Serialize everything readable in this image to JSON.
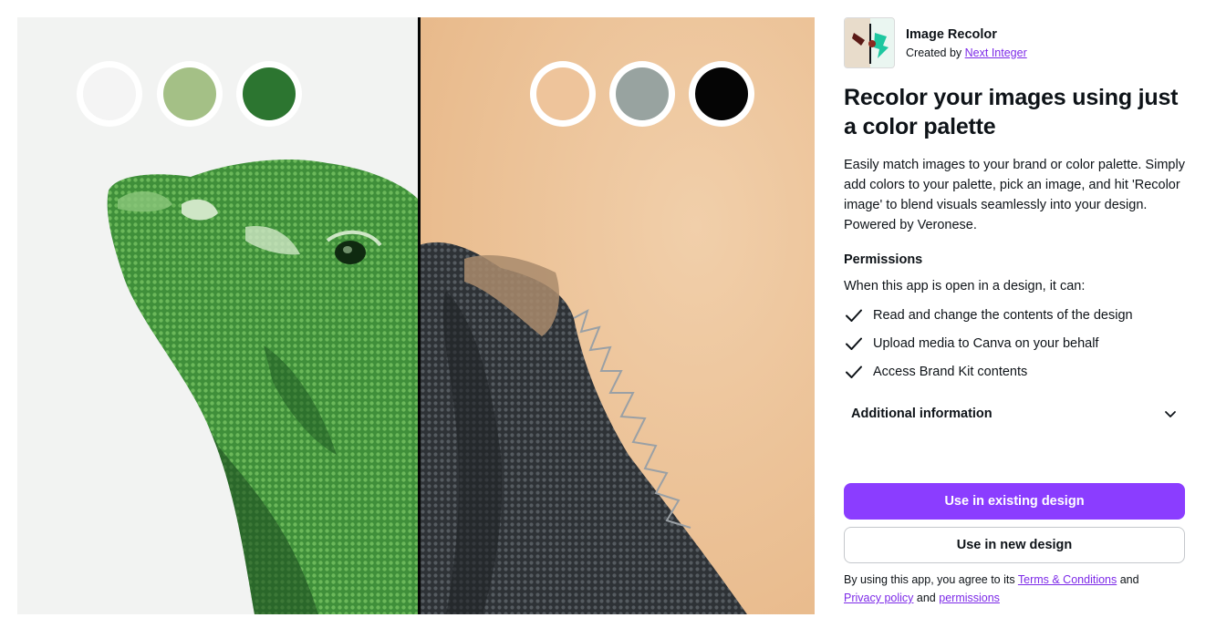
{
  "app": {
    "name": "Image Recolor",
    "created_by_prefix": "Created by",
    "creator": "Next Integer",
    "logo_icon": "recolor-logo-icon"
  },
  "hero": {
    "left_palette": [
      "#f4f4f4",
      "#a4c086",
      "#2c7530"
    ],
    "right_palette": [
      "#eec49b",
      "#98a3a0",
      "#050505"
    ],
    "left_background": "#f2f3f2",
    "right_background": "#eec49b"
  },
  "headline": "Recolor your images using just a color palette",
  "description": "Easily match images to your brand or color palette. Simply add colors to your palette, pick an image, and hit 'Recolor image' to blend visuals seamlessly into your design. Powered by Veronese.",
  "permissions": {
    "title": "Permissions",
    "intro": "When this app is open in a design, it can:",
    "items": [
      "Read and change the contents of the design",
      "Upload media to Canva on your behalf",
      "Access Brand Kit contents"
    ]
  },
  "additional_info": {
    "label": "Additional information",
    "icon": "chevron-down-icon"
  },
  "buttons": {
    "existing": "Use in existing design",
    "new": "Use in new design"
  },
  "legal": {
    "prefix": "By using this app, you agree to its",
    "terms": "Terms & Conditions",
    "and1": "and",
    "privacy": "Privacy policy",
    "and2": "and",
    "permissions": "permissions"
  },
  "colors": {
    "accent": "#8b3dff",
    "link": "#7d2ae8",
    "text": "#0e1318"
  }
}
